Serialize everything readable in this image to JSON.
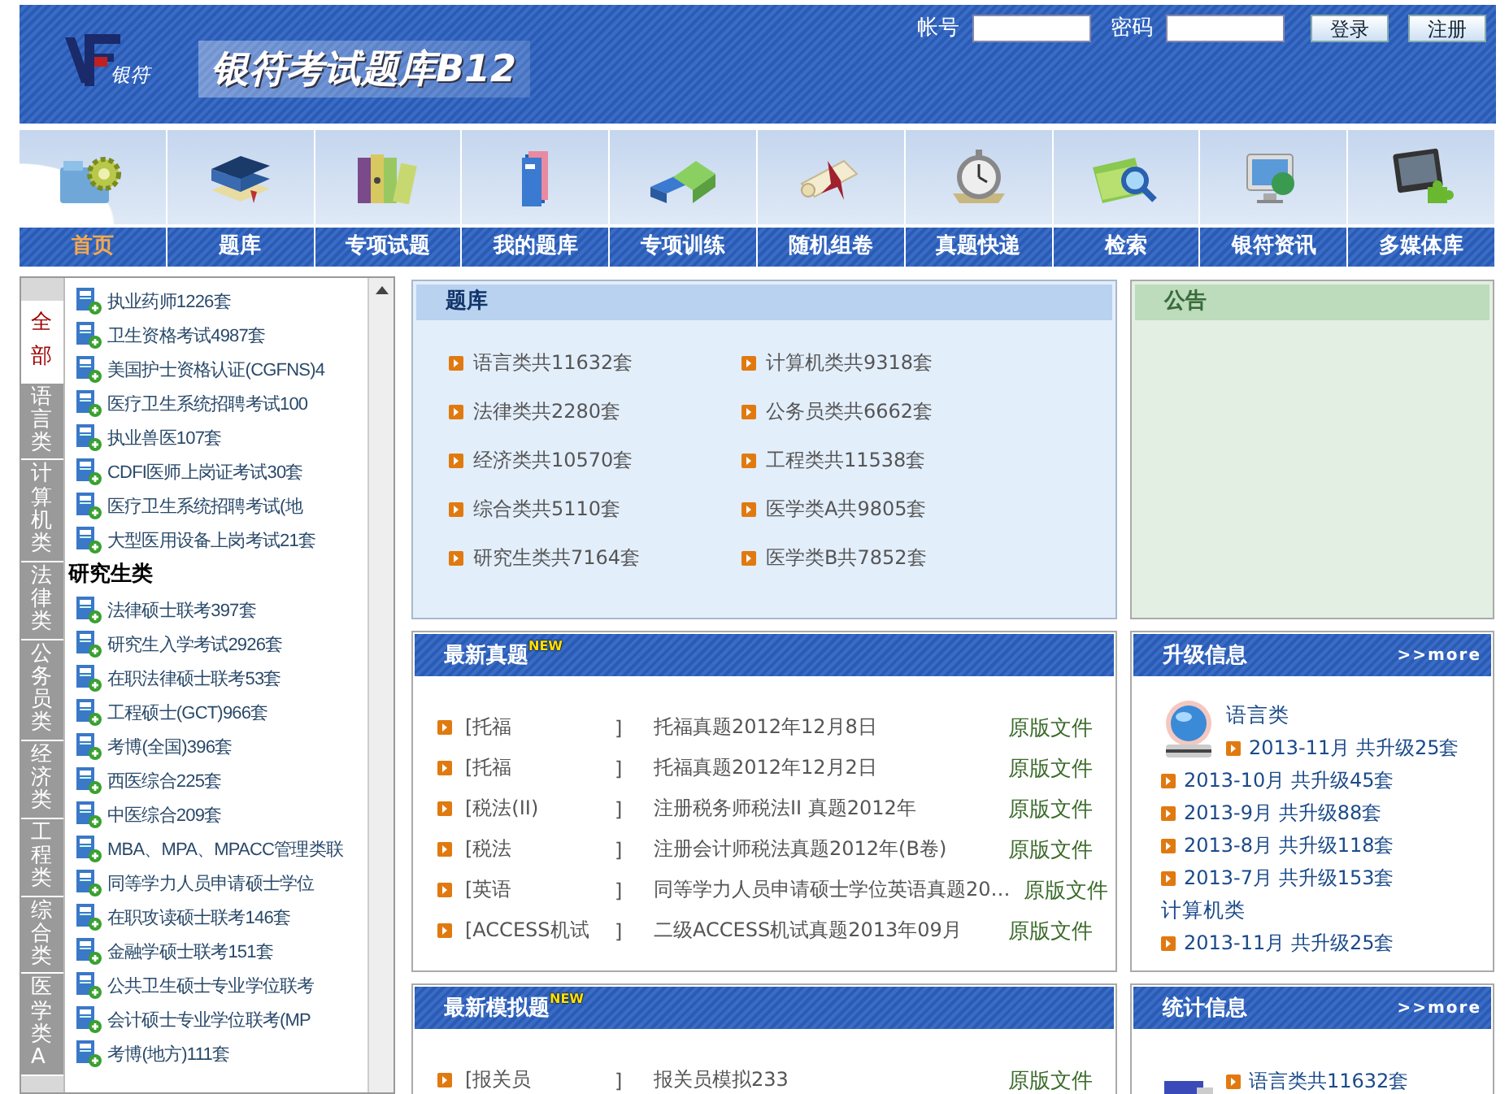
{
  "header": {
    "logo_text": "银符",
    "title": "银符考试题库B12",
    "account_label": "帐号",
    "password_label": "密码",
    "buttons": [
      "登录",
      "注册"
    ]
  },
  "nav": {
    "items": [
      {
        "label": "首页",
        "selected": true
      },
      {
        "label": "题库",
        "selected": false
      },
      {
        "label": "专项试题",
        "selected": false
      },
      {
        "label": "我的题库",
        "selected": false
      },
      {
        "label": "专项训练",
        "selected": false
      },
      {
        "label": "随机组卷",
        "selected": false
      },
      {
        "label": "真题快递",
        "selected": false
      },
      {
        "label": "检索",
        "selected": false
      },
      {
        "label": "银符资讯",
        "selected": false
      },
      {
        "label": "多媒体库",
        "selected": false
      }
    ]
  },
  "sidebar": {
    "tabs": [
      {
        "label": "全部",
        "selected": true
      },
      {
        "label": "语言类",
        "selected": false
      },
      {
        "label": "计算机类",
        "selected": false
      },
      {
        "label": "法律类",
        "selected": false
      },
      {
        "label": "公务员类",
        "selected": false
      },
      {
        "label": "经济类",
        "selected": false
      },
      {
        "label": "工程类",
        "selected": false
      },
      {
        "label": "综合类",
        "selected": false
      },
      {
        "label": "医学类A",
        "selected": false
      }
    ],
    "entries": [
      {
        "kind": "item",
        "text": "执业药师1226套"
      },
      {
        "kind": "item",
        "text": "卫生资格考试4987套"
      },
      {
        "kind": "item",
        "text": "美国护士资格认证(CGFNS)4"
      },
      {
        "kind": "item",
        "text": "医疗卫生系统招聘考试100"
      },
      {
        "kind": "item",
        "text": "执业兽医107套"
      },
      {
        "kind": "item",
        "text": "CDFI医师上岗证考试30套"
      },
      {
        "kind": "item",
        "text": "医疗卫生系统招聘考试(地"
      },
      {
        "kind": "item",
        "text": "大型医用设备上岗考试21套"
      },
      {
        "kind": "group",
        "text": "研究生类"
      },
      {
        "kind": "item",
        "text": "法律硕士联考397套"
      },
      {
        "kind": "item",
        "text": "研究生入学考试2926套"
      },
      {
        "kind": "item",
        "text": "在职法律硕士联考53套"
      },
      {
        "kind": "item",
        "text": "工程硕士(GCT)966套"
      },
      {
        "kind": "item",
        "text": "考博(全国)396套"
      },
      {
        "kind": "item",
        "text": "西医综合225套"
      },
      {
        "kind": "item",
        "text": "中医综合209套"
      },
      {
        "kind": "item",
        "text": "MBA、MPA、MPACC管理类联"
      },
      {
        "kind": "item",
        "text": "同等学力人员申请硕士学位"
      },
      {
        "kind": "item",
        "text": "在职攻读硕士联考146套"
      },
      {
        "kind": "item",
        "text": "金融学硕士联考151套"
      },
      {
        "kind": "item",
        "text": "公共卫生硕士专业学位联考"
      },
      {
        "kind": "item",
        "text": "会计硕士专业学位联考(MP"
      },
      {
        "kind": "item",
        "text": "考博(地方)111套"
      }
    ]
  },
  "question_bank": {
    "title": "题库",
    "items": [
      "语言类共11632套",
      "计算机类共9318套",
      "法律类共2280套",
      "公务员类共6662套",
      "经济类共10570套",
      "工程类共11538套",
      "综合类共5110套",
      "医学类A共9805套",
      "研究生类共7164套",
      "医学类B共7852套"
    ]
  },
  "latest_real": {
    "title": "最新真题",
    "badge": "NEW",
    "rows": [
      {
        "category": "[托福",
        "close": "]",
        "title": "托福真题2012年12月8日",
        "link": "原版文件"
      },
      {
        "category": "[托福",
        "close": "]",
        "title": "托福真题2012年12月2日",
        "link": "原版文件"
      },
      {
        "category": "[税法(II)",
        "close": "]",
        "title": "注册税务师税法II 真题2012年",
        "link": "原版文件"
      },
      {
        "category": "[税法",
        "close": "]",
        "title": "注册会计师税法真题2012年(B卷)",
        "link": "原版文件"
      },
      {
        "category": "[英语",
        "close": "]",
        "title": "同等学力人员申请硕士学位英语真题20…",
        "link": "原版文件"
      },
      {
        "category": "[ACCESS机试",
        "close": "]",
        "title": "二级ACCESS机试真题2013年09月",
        "link": "原版文件"
      }
    ]
  },
  "latest_mock": {
    "title": "最新模拟题",
    "badge": "NEW",
    "rows": [
      {
        "category": "[报关员",
        "close": "]",
        "title": "报关员模拟233",
        "link": "原版文件"
      }
    ]
  },
  "notice": {
    "title": "公告"
  },
  "upgrade": {
    "title": "升级信息",
    "more": ">>more",
    "groups": [
      {
        "kind": "featured",
        "category": "语言类",
        "entries": [
          "2013-11月 共升级25套",
          "2013-10月 共升级45套",
          "2013-9月 共升级88套",
          "2013-8月 共升级118套",
          "2013-7月 共升级153套"
        ]
      },
      {
        "kind": "plain",
        "category": "计算机类",
        "entries": [
          "2013-11月 共升级25套"
        ]
      }
    ]
  },
  "stats": {
    "title": "统计信息",
    "more": ">>more",
    "entries": [
      "语言类共11632套"
    ]
  }
}
